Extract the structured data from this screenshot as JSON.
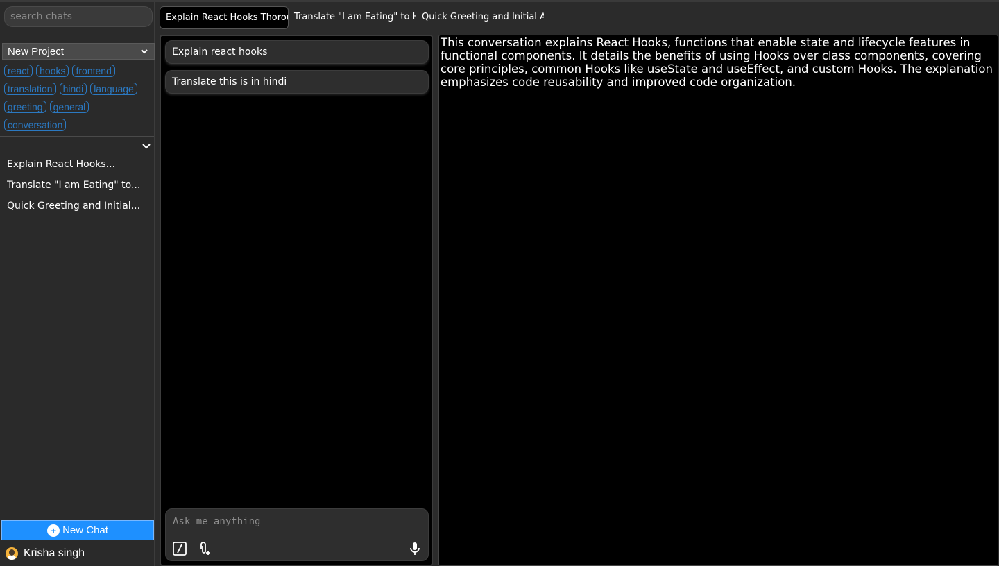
{
  "sidebar": {
    "search_placeholder": "search chats",
    "project": "New Project",
    "tags": [
      "react",
      "hooks",
      "frontend",
      "translation",
      "hindi",
      "language",
      "greeting",
      "general",
      "conversation"
    ],
    "history": [
      "Explain React Hooks...",
      "Translate \"I am Eating\" to...",
      "Quick Greeting and Initial..."
    ],
    "new_chat_label": "New Chat",
    "user_name": "Krisha singh"
  },
  "tabs": [
    "Explain React Hooks Thorough",
    "Translate \"I am Eating\" to Hin",
    "Quick Greeting and Initial As"
  ],
  "chat": {
    "messages": [
      "Explain react hooks",
      "Translate this is in hindi"
    ],
    "composer_placeholder": "Ask me anything"
  },
  "summary": "This conversation explains React Hooks, functions that enable state and lifecycle features in functional components. It details the benefits of using Hooks over class components, covering core principles, common Hooks like useState and useEffect, and custom Hooks. The explanation emphasizes code reusability and improved code organization.",
  "colors": {
    "accent": "#1e90ff",
    "tag": "#2b79c2",
    "background": "#2b2b2b",
    "panel": "#000000"
  },
  "icons": [
    "chevron-down-icon",
    "plus-circle-icon",
    "avatar-icon",
    "slash-command-icon",
    "attach-icon",
    "mic-icon"
  ]
}
